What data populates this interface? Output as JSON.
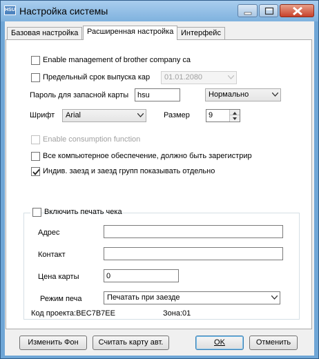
{
  "window": {
    "title": "Настройка системы",
    "icon_text": "HSU",
    "controls": {
      "minimize": "minimize-icon",
      "maximize": "maximize-icon",
      "close": "close-icon"
    }
  },
  "tabs": [
    {
      "label": "Базовая настройка",
      "active": false
    },
    {
      "label": "Расширенная настройка",
      "active": true
    },
    {
      "label": "Интерфейс",
      "active": false
    }
  ],
  "advanced": {
    "brother_management": {
      "label": "Enable management of brother company ca",
      "checked": false
    },
    "card_expiry": {
      "label": "Предельный срок выпуска кар",
      "checked": false,
      "date": "01.01.2080"
    },
    "backup_card_password": {
      "label": "Пароль для запасной карты",
      "value": "hsu",
      "mode": "Нормально"
    },
    "font": {
      "label": "Шрифт",
      "value": "Arial",
      "size_label": "Размер",
      "size_value": "9"
    },
    "consumption": {
      "label": "Enable consumption function",
      "checked": false,
      "disabled": true
    },
    "software_registered": {
      "label": "Все компьютерное обеспечение, должно быть зарегистрир",
      "checked": false
    },
    "individual_group_checkin": {
      "label": "Индив. заезд и заезд групп показывать отдельно",
      "checked": true
    },
    "receipt": {
      "label": "Включить печать чека",
      "checked": false,
      "address_label": "Адрес",
      "address_value": "",
      "contact_label": "Контакт",
      "contact_value": "",
      "card_price_label": "Цена карты",
      "card_price_value": "0",
      "print_mode_label": "Режим печа",
      "print_mode_value": "Печатать при заезде"
    }
  },
  "status": {
    "project_code": "Код проекта:BEC7B7EE",
    "zone": "Зона:01"
  },
  "buttons": {
    "change_bg": "Изменить Фон",
    "read_card": "Считать карту авт.",
    "ok": "OK",
    "cancel": "Отменить"
  },
  "colors": {
    "titlebar": "#8fbbe3",
    "close": "#c7412b",
    "panel": "#f0f0f0"
  }
}
